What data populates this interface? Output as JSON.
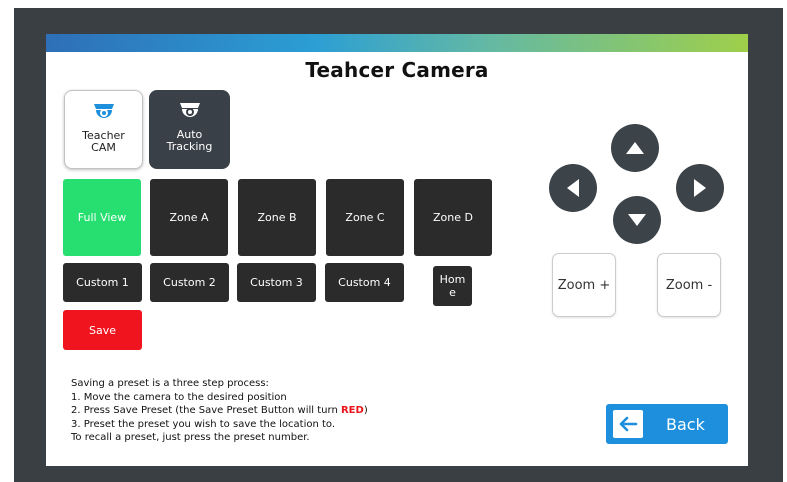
{
  "title": "Teahcer Camera",
  "modes": {
    "teacher": {
      "line1": "Teacher",
      "line2": "CAM"
    },
    "auto": {
      "line1": "Auto",
      "line2": "Tracking"
    }
  },
  "presets_row1": [
    "Full View",
    "Zone A",
    "Zone B",
    "Zone C",
    "Zone D"
  ],
  "presets_row2": [
    "Custom 1",
    "Custom 2",
    "Custom 3",
    "Custom 4"
  ],
  "home": {
    "line1": "Hom",
    "line2": "e"
  },
  "save_label": "Save",
  "ptz": {
    "up_icon": "arrow-up-icon",
    "down_icon": "arrow-down-icon",
    "left_icon": "arrow-left-icon",
    "right_icon": "arrow-right-icon"
  },
  "zoom": {
    "in_label": "Zoom +",
    "out_label": "Zoom -"
  },
  "instructions": {
    "line1": "Saving a preset is a three step process:",
    "line2": "1. Move the camera to the desired position",
    "line3_before": "2. Press Save Preset (the Save Preset Button will turn ",
    "line3_highlight": "RED",
    "line3_after": ")",
    "line4": "3. Preset the preset you wish to save the location to.",
    "line5": "To recall a preset, just press the preset number."
  },
  "back_label": "Back",
  "colors": {
    "active_preset": "#26df70",
    "save": "#f0141e",
    "back": "#1e8fdc",
    "dark_button": "#2b2b2b",
    "arrow_button": "#3c4349"
  }
}
